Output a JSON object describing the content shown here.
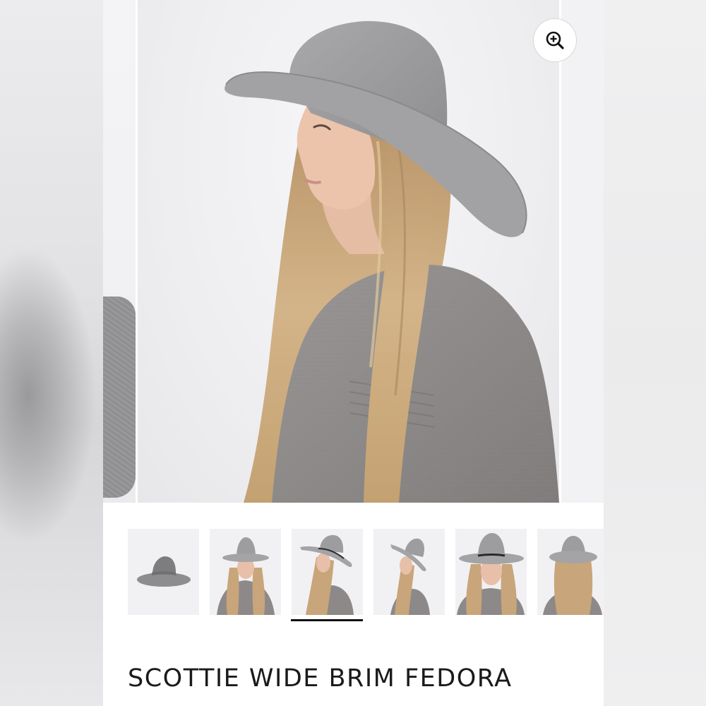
{
  "product": {
    "title": "SCOTTIE WIDE BRIM FEDORA",
    "gallery": {
      "zoom_icon": "zoom-in-icon",
      "active_image_index": 2,
      "thumbnails": [
        {
          "label": "hat-only"
        },
        {
          "label": "front-view"
        },
        {
          "label": "side-view"
        },
        {
          "label": "side-view-2"
        },
        {
          "label": "front-closeup"
        },
        {
          "label": "back-view"
        }
      ]
    }
  },
  "colors": {
    "hat": "#9d9d9f",
    "sweater": "#8f8c8b",
    "hair": "#c8a57a",
    "skin": "#e8bfa8",
    "indicator": "#111111"
  }
}
